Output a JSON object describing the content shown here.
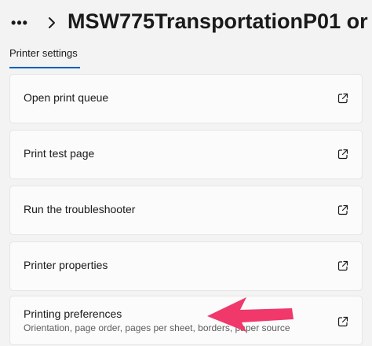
{
  "header": {
    "more_label": "•••",
    "title": "MSW775TransportationP01 or"
  },
  "section": {
    "label": "Printer settings"
  },
  "items": [
    {
      "label": "Open print queue",
      "icon": "external-link-icon"
    },
    {
      "label": "Print test page",
      "icon": "external-link-icon"
    },
    {
      "label": "Run the troubleshooter",
      "icon": "external-link-icon"
    },
    {
      "label": "Printer properties",
      "icon": "external-link-icon"
    },
    {
      "label": "Printing preferences",
      "description": "Orientation, page order, pages per sheet, borders, paper source",
      "icon": "external-link-icon"
    }
  ],
  "colors": {
    "accent": "#005fb8",
    "annotation_arrow": "#f0386b"
  }
}
